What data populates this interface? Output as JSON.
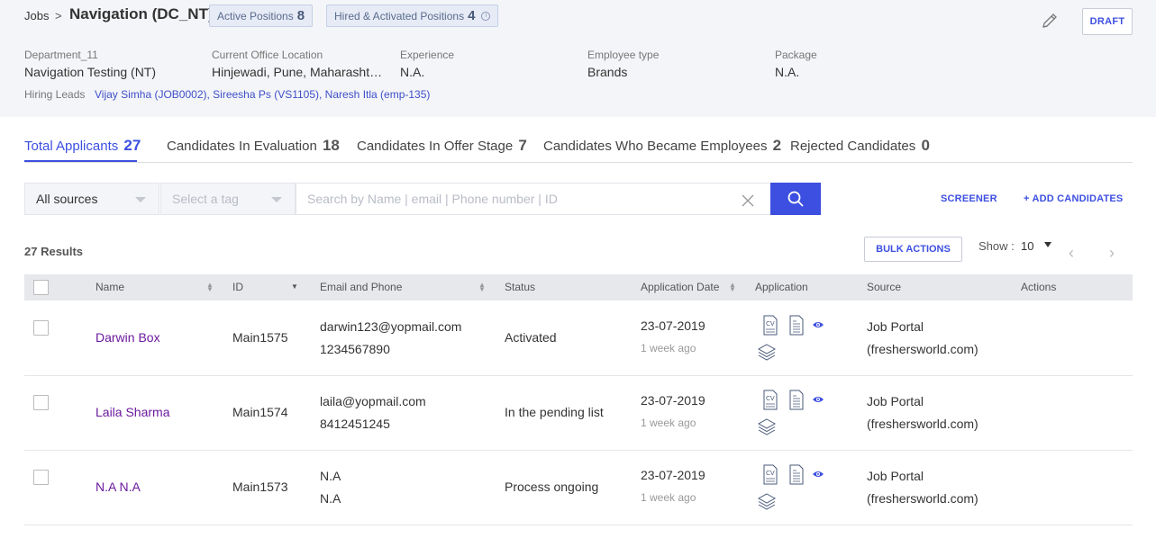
{
  "header": {
    "breadcrumb": "Jobs",
    "separator": ">",
    "title": "Navigation (DC_NT)",
    "active_positions": {
      "label": "Active Positions",
      "count": "8"
    },
    "hired_positions": {
      "label": "Hired & Activated Positions",
      "count": "4"
    },
    "status_button": "DRAFT",
    "department": {
      "label": "Department_11",
      "value": "Navigation Testing (NT)"
    },
    "office": {
      "label": "Current Office Location",
      "value": "Hinjewadi, Pune, Maharashtr..."
    },
    "experience": {
      "label": "Experience",
      "value": "N.A."
    },
    "employee_type": {
      "label": "Employee type",
      "value": "Brands"
    },
    "package": {
      "label": "Package",
      "value": "N.A."
    },
    "hiring_leads": {
      "label": "Hiring Leads",
      "value": "Vijay Simha (JOB0002), Sireesha Ps (VS1105), Naresh Itla (emp-135)"
    }
  },
  "tabs": [
    {
      "label": "Total Applicants",
      "count": "27"
    },
    {
      "label": "Candidates In Evaluation",
      "count": "18"
    },
    {
      "label": "Candidates In Offer Stage",
      "count": "7"
    },
    {
      "label": "Candidates Who Became Employees",
      "count": "2"
    },
    {
      "label": "Rejected Candidates",
      "count": "0"
    }
  ],
  "filters": {
    "source": "All sources",
    "tag_placeholder": "Select a tag",
    "search_placeholder": "Search by Name | email | Phone number | ID",
    "screener": "SCREENER",
    "add_candidates": "+ ADD CANDIDATES"
  },
  "results": {
    "count_text": "27 Results",
    "bulk_actions": "BULK ACTIONS",
    "show_label": "Show :",
    "show_value": "10",
    "prev": "‹",
    "next": "›"
  },
  "table": {
    "headers": {
      "name": "Name",
      "id": "ID",
      "email_phone": "Email and Phone",
      "status": "Status",
      "application_date": "Application Date",
      "application": "Application",
      "source": "Source",
      "actions": "Actions"
    },
    "rows": [
      {
        "name": "Darwin Box",
        "id": "Main1575",
        "email": "darwin123@yopmail.com",
        "phone": "1234567890",
        "status": "Activated",
        "date": "23-07-2019",
        "ago": "1 week ago",
        "source1": "Job Portal",
        "source2": "(freshersworld.com)"
      },
      {
        "name": "Laila Sharma",
        "id": "Main1574",
        "email": "laila@yopmail.com",
        "phone": "8412451245",
        "status": "In the pending list",
        "date": "23-07-2019",
        "ago": "1 week ago",
        "source1": "Job Portal",
        "source2": "(freshersworld.com)"
      },
      {
        "name": "N.A N.A",
        "id": "Main1573",
        "email": "N.A",
        "phone": "N.A",
        "status": "Process ongoing",
        "date": "23-07-2019",
        "ago": "1 week ago",
        "source1": "Job Portal",
        "source2": "(freshersworld.com)"
      }
    ]
  },
  "colors": {
    "accent": "#3d4fe0",
    "name_link": "#6b1a9e",
    "header_bg": "#f4f5f8"
  }
}
